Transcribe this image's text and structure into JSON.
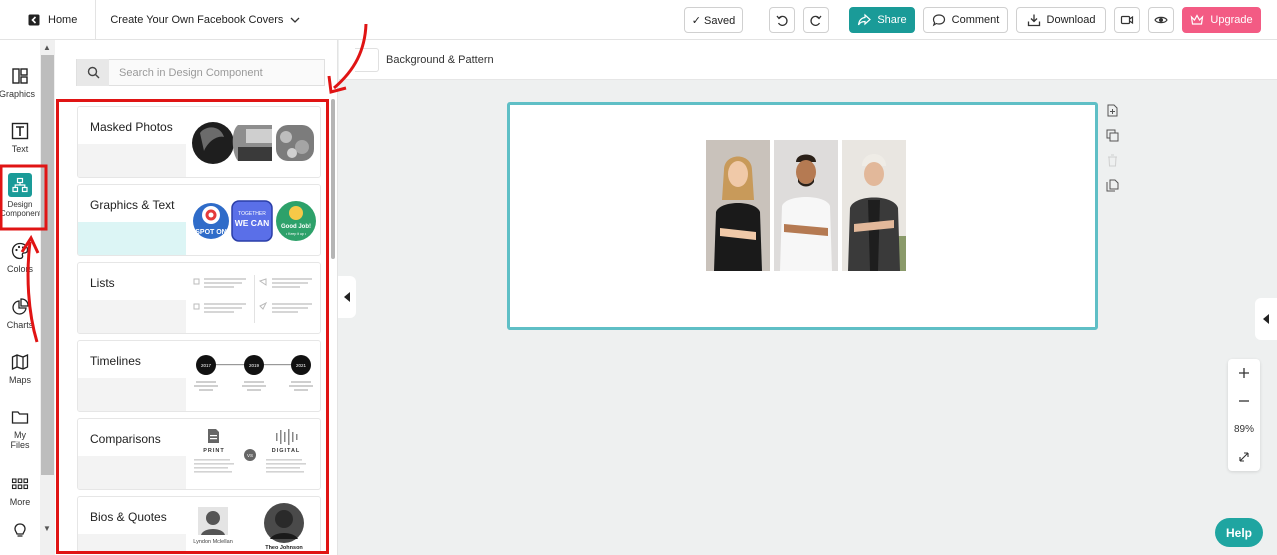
{
  "header": {
    "home_label": "Home",
    "doc_title": "Create Your Own Facebook Covers",
    "saved_label": "✓ Saved",
    "share_label": "Share",
    "comment_label": "Comment",
    "download_label": "Download",
    "upgrade_label": "Upgrade"
  },
  "rail": {
    "items": [
      {
        "label": "Graphics",
        "icon": "graphics-icon"
      },
      {
        "label": "Text",
        "icon": "text-icon"
      },
      {
        "label": "Design Components",
        "icon": "design-components-icon"
      },
      {
        "label": "Colors",
        "icon": "palette-icon"
      },
      {
        "label": "Charts",
        "icon": "chart-icon"
      },
      {
        "label": "Maps",
        "icon": "map-icon"
      },
      {
        "label": "My Files",
        "icon": "folder-icon"
      },
      {
        "label": "More",
        "icon": "grid-icon"
      }
    ]
  },
  "panel": {
    "search_placeholder": "Search in Design Component",
    "cards": [
      {
        "title": "Masked Photos"
      },
      {
        "title": "Graphics & Text",
        "badges": [
          "SPOT ON",
          "TOGETHER",
          "WE CAN",
          "Good Job!",
          "• Keep it up •"
        ]
      },
      {
        "title": "Lists"
      },
      {
        "title": "Timelines",
        "years": [
          "2017",
          "2019",
          "2021"
        ]
      },
      {
        "title": "Comparisons",
        "left": "PRINT",
        "vs": "VS",
        "right": "DIGITAL"
      },
      {
        "title": "Bios & Quotes",
        "names": [
          "Lyndon Mclellan",
          "Theo Johnson"
        ]
      }
    ]
  },
  "toolbar": {
    "background_label": "Background & Pattern"
  },
  "zoom": {
    "level": "89%"
  },
  "help_label": "Help",
  "colors": {
    "brand_teal": "#1a9b98",
    "upgrade_pink": "#f35b84",
    "canvas_border": "#5fbfc6",
    "annotation_red": "#e01414"
  }
}
